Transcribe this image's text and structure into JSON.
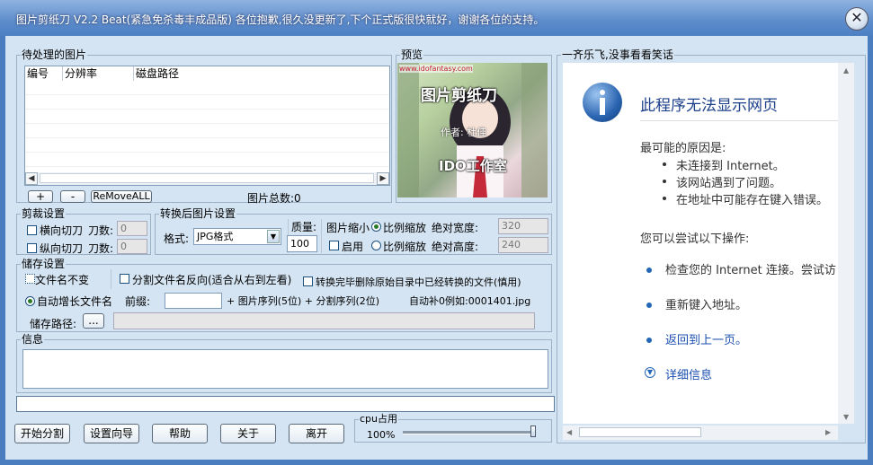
{
  "window": {
    "title": "图片剪纸刀 V2.2 Beat(紧急免杀毒丰成品版) 各位抱歉,很久没更新了,下个正式版很快就好，谢谢各位的支持。",
    "close_glyph": "✕"
  },
  "pending": {
    "group_title": "待处理的图片",
    "columns": [
      "编号",
      "分辨率",
      "磁盘路径"
    ],
    "add_label": "+",
    "remove_label": "-",
    "remove_all_label": "ReMoveALL",
    "total_label": "图片总数:0"
  },
  "preview": {
    "group_title": "预览",
    "url_text": "www.idofantasy.com",
    "art_title": "图片剪纸刀",
    "art_author": "作者: 杜佳",
    "art_studio": "IDO工作室"
  },
  "cut": {
    "group_title": "剪裁设置",
    "horizontal_label": "横向切刀",
    "vertical_label": "纵向切刀",
    "knife_count_label": "刀数:",
    "h_count": "0",
    "v_count": "0"
  },
  "format": {
    "group_title": "转换后图片设置",
    "format_label": "格式:",
    "format_value": "JPG格式",
    "quality_label": "质量:",
    "quality_value": "100",
    "shrink_label": "图片缩小",
    "enable_label": "启用",
    "proportional_label": "比例缩放",
    "abs_width_label": "绝对宽度:",
    "abs_height_label": "绝对高度:",
    "width_value": "320",
    "height_value": "240"
  },
  "storage": {
    "group_title": "储存设置",
    "filename_unchanged_label": "文件名不变",
    "reverse_label": "分割文件名反向(适合从右到左看)",
    "delete_label": "转换完毕删除原始目录中已经转换的文件(慎用)",
    "auto_increment_label": "自动增长文件名",
    "prefix_label": "前缀:",
    "formula_text": "+  图片序列(5位) + 分割序列(2位)",
    "example_text": "自动补0例如:0001401.jpg",
    "path_label": "储存路径:",
    "browse_label": "..."
  },
  "info": {
    "group_title": "信息"
  },
  "bottom": {
    "start_label": "开始分割",
    "wizard_label": "设置向导",
    "help_label": "帮助",
    "about_label": "关于",
    "exit_label": "离开",
    "cpu_title": "cpu占用",
    "cpu_value": "100%",
    "cpu_fraction": 1.0
  },
  "browser_panel": {
    "group_title": "一齐乐飞,没事看看笑话",
    "error_title": "此程序无法显示网页",
    "cause_heading": "最可能的原因是:",
    "causes": [
      "未连接到 Internet。",
      "该网站遇到了问题。",
      "在地址中可能存在键入错误。"
    ],
    "try_heading": "您可以尝试以下操作:",
    "actions": [
      "检查您的 Internet 连接。尝试访",
      "重新键入地址。",
      "返回到上一页。"
    ],
    "details_label": "详细信息"
  },
  "colors": {
    "accent": "#2466b8",
    "panel": "#d5e4f2",
    "titlebar": "#5d8ccb"
  }
}
